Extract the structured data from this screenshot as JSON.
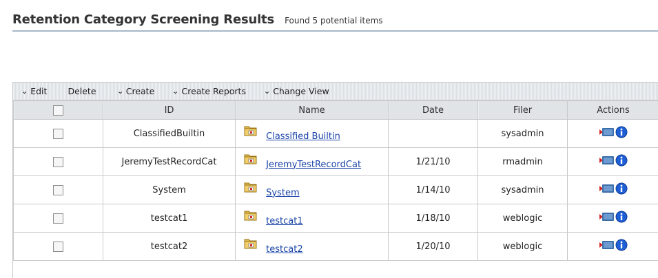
{
  "page": {
    "title": "Retention Category Screening Results",
    "subtitle": "Found 5 potential items"
  },
  "toolbar": {
    "edit": "Edit",
    "delete": "Delete",
    "create": "Create",
    "create_reports": "Create Reports",
    "change_view": "Change View"
  },
  "table": {
    "columns": {
      "id": "ID",
      "name": "Name",
      "date": "Date",
      "filer": "Filer",
      "actions": "Actions"
    },
    "rows": [
      {
        "id": "ClassifiedBuiltin",
        "name": "Classified Builtin",
        "date": "",
        "filer": "sysadmin"
      },
      {
        "id": "JeremyTestRecordCat",
        "name": "JeremyTestRecordCat",
        "date": "1/21/10",
        "filer": "rmadmin"
      },
      {
        "id": "System",
        "name": "System",
        "date": "1/14/10",
        "filer": "sysadmin"
      },
      {
        "id": "testcat1",
        "name": "testcat1",
        "date": "1/18/10",
        "filer": "weblogic"
      },
      {
        "id": "testcat2",
        "name": "testcat2",
        "date": "1/20/10",
        "filer": "weblogic"
      }
    ]
  },
  "icons": {
    "caret": "chevron-down-icon",
    "folder": "category-folder-icon",
    "action_flag": "action-menu-icon",
    "info": "info-icon"
  },
  "colors": {
    "link": "#1a44a8",
    "header_rule": "#a5b6c8",
    "info_blue": "#1f5fd6"
  }
}
